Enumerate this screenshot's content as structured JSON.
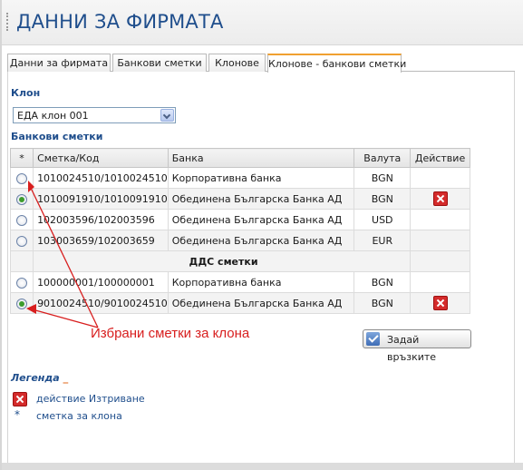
{
  "page": {
    "title": "ДАННИ ЗА ФИРМАТА"
  },
  "tabs": [
    {
      "label": "Данни за фирмата",
      "active": false
    },
    {
      "label": "Банкови сметки",
      "active": false
    },
    {
      "label": "Клонове",
      "active": false
    },
    {
      "label": "Клонове - банкови сметки",
      "active": true
    }
  ],
  "branch": {
    "label": "Клон",
    "selected": "ЕДА клон 001"
  },
  "accounts": {
    "label": "Банкови сметки",
    "columns": [
      "*",
      "Сметка/Код",
      "Банка",
      "Валута",
      "Действие"
    ],
    "rows": [
      {
        "selected": false,
        "account": "1010024510/1010024510",
        "bank": "Корпоративна банка",
        "currency": "BGN",
        "delete": false
      },
      {
        "selected": true,
        "account": "1010091910/1010091910",
        "bank": "Обединена Българска Банка АД",
        "currency": "BGN",
        "delete": true
      },
      {
        "selected": false,
        "account": "102003596/102003596",
        "bank": "Обединена Българска Банка АД",
        "currency": "USD",
        "delete": false
      },
      {
        "selected": false,
        "account": "103003659/102003659",
        "bank": "Обединена Българска Банка АД",
        "currency": "EUR",
        "delete": false
      }
    ],
    "vat_title": "ДДС сметки",
    "vat_rows": [
      {
        "selected": false,
        "account": "100000001/100000001",
        "bank": "Корпоративна банка",
        "currency": "BGN",
        "delete": false
      },
      {
        "selected": true,
        "account": "9010024510/9010024510",
        "bank": "Обединена Българска Банка АД",
        "currency": "BGN",
        "delete": true
      }
    ]
  },
  "annotation": {
    "text": "Избрани сметки за клона",
    "color": "#d81e1e"
  },
  "buttons": {
    "link": "Задай връзките"
  },
  "legend": {
    "title": "Легенда",
    "items": [
      {
        "icon": "delete-icon",
        "text": "действие Изтриване"
      },
      {
        "icon": "asterisk",
        "symbol": "*",
        "text": "сметка за клона"
      }
    ]
  },
  "colors": {
    "accent": "#1f4e8c",
    "tab_highlight": "#f0a030",
    "delete": "#d42b2b"
  }
}
